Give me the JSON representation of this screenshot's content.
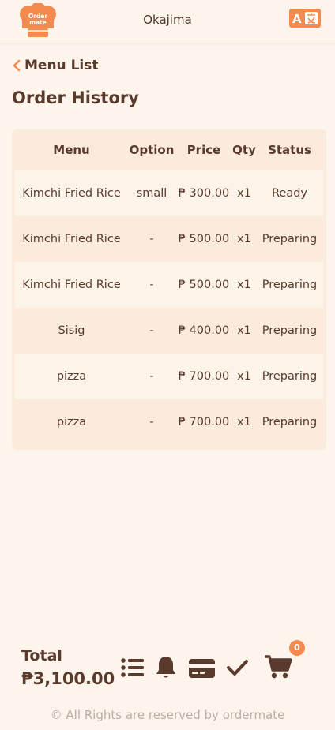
{
  "header": {
    "logo_text_line1": "Order",
    "logo_text_line2": "mate",
    "store_name": "Okajima",
    "translate_icon": "translate-icon"
  },
  "nav": {
    "back_label": "Menu List",
    "back_icon": "chevron-left-icon"
  },
  "page": {
    "title": "Order History"
  },
  "table": {
    "columns": [
      "Menu",
      "Option",
      "Price",
      "Qty",
      "Status"
    ],
    "rows": [
      {
        "menu": "Kimchi Fried Rice",
        "option": "small",
        "price": "₱ 300.00",
        "qty": "x1",
        "status": "Ready"
      },
      {
        "menu": "Kimchi Fried Rice",
        "option": "-",
        "price": "₱ 500.00",
        "qty": "x1",
        "status": "Preparing"
      },
      {
        "menu": "Kimchi Fried Rice",
        "option": "-",
        "price": "₱ 500.00",
        "qty": "x1",
        "status": "Preparing"
      },
      {
        "menu": "Sisig",
        "option": "-",
        "price": "₱ 400.00",
        "qty": "x1",
        "status": "Preparing"
      },
      {
        "menu": "pizza",
        "option": "-",
        "price": "₱ 700.00",
        "qty": "x1",
        "status": "Preparing"
      },
      {
        "menu": "pizza",
        "option": "-",
        "price": "₱ 700.00",
        "qty": "x1",
        "status": "Preparing"
      }
    ]
  },
  "footer": {
    "total_label": "Total",
    "total_amount": "₱3,100.00",
    "cart_count": "0",
    "icons": [
      "list-icon",
      "bell-icon",
      "credit-card-icon",
      "check-icon",
      "cart-icon"
    ],
    "copyright": "© All Rights are reserved by ordermate"
  },
  "colors": {
    "background": "#fdf5ec",
    "accent": "#f58a4f",
    "text": "#5a3a2c",
    "table_bg": "#faebdd",
    "row_alt": "#fcf3e9"
  }
}
